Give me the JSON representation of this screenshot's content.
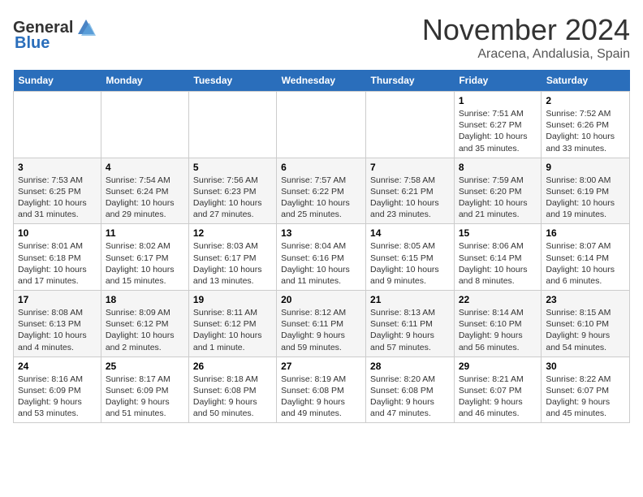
{
  "header": {
    "logo_general": "General",
    "logo_blue": "Blue",
    "month": "November 2024",
    "location": "Aracena, Andalusia, Spain"
  },
  "weekdays": [
    "Sunday",
    "Monday",
    "Tuesday",
    "Wednesday",
    "Thursday",
    "Friday",
    "Saturday"
  ],
  "weeks": [
    [
      {
        "day": "",
        "info": ""
      },
      {
        "day": "",
        "info": ""
      },
      {
        "day": "",
        "info": ""
      },
      {
        "day": "",
        "info": ""
      },
      {
        "day": "",
        "info": ""
      },
      {
        "day": "1",
        "info": "Sunrise: 7:51 AM\nSunset: 6:27 PM\nDaylight: 10 hours and 35 minutes."
      },
      {
        "day": "2",
        "info": "Sunrise: 7:52 AM\nSunset: 6:26 PM\nDaylight: 10 hours and 33 minutes."
      }
    ],
    [
      {
        "day": "3",
        "info": "Sunrise: 7:53 AM\nSunset: 6:25 PM\nDaylight: 10 hours and 31 minutes."
      },
      {
        "day": "4",
        "info": "Sunrise: 7:54 AM\nSunset: 6:24 PM\nDaylight: 10 hours and 29 minutes."
      },
      {
        "day": "5",
        "info": "Sunrise: 7:56 AM\nSunset: 6:23 PM\nDaylight: 10 hours and 27 minutes."
      },
      {
        "day": "6",
        "info": "Sunrise: 7:57 AM\nSunset: 6:22 PM\nDaylight: 10 hours and 25 minutes."
      },
      {
        "day": "7",
        "info": "Sunrise: 7:58 AM\nSunset: 6:21 PM\nDaylight: 10 hours and 23 minutes."
      },
      {
        "day": "8",
        "info": "Sunrise: 7:59 AM\nSunset: 6:20 PM\nDaylight: 10 hours and 21 minutes."
      },
      {
        "day": "9",
        "info": "Sunrise: 8:00 AM\nSunset: 6:19 PM\nDaylight: 10 hours and 19 minutes."
      }
    ],
    [
      {
        "day": "10",
        "info": "Sunrise: 8:01 AM\nSunset: 6:18 PM\nDaylight: 10 hours and 17 minutes."
      },
      {
        "day": "11",
        "info": "Sunrise: 8:02 AM\nSunset: 6:17 PM\nDaylight: 10 hours and 15 minutes."
      },
      {
        "day": "12",
        "info": "Sunrise: 8:03 AM\nSunset: 6:17 PM\nDaylight: 10 hours and 13 minutes."
      },
      {
        "day": "13",
        "info": "Sunrise: 8:04 AM\nSunset: 6:16 PM\nDaylight: 10 hours and 11 minutes."
      },
      {
        "day": "14",
        "info": "Sunrise: 8:05 AM\nSunset: 6:15 PM\nDaylight: 10 hours and 9 minutes."
      },
      {
        "day": "15",
        "info": "Sunrise: 8:06 AM\nSunset: 6:14 PM\nDaylight: 10 hours and 8 minutes."
      },
      {
        "day": "16",
        "info": "Sunrise: 8:07 AM\nSunset: 6:14 PM\nDaylight: 10 hours and 6 minutes."
      }
    ],
    [
      {
        "day": "17",
        "info": "Sunrise: 8:08 AM\nSunset: 6:13 PM\nDaylight: 10 hours and 4 minutes."
      },
      {
        "day": "18",
        "info": "Sunrise: 8:09 AM\nSunset: 6:12 PM\nDaylight: 10 hours and 2 minutes."
      },
      {
        "day": "19",
        "info": "Sunrise: 8:11 AM\nSunset: 6:12 PM\nDaylight: 10 hours and 1 minute."
      },
      {
        "day": "20",
        "info": "Sunrise: 8:12 AM\nSunset: 6:11 PM\nDaylight: 9 hours and 59 minutes."
      },
      {
        "day": "21",
        "info": "Sunrise: 8:13 AM\nSunset: 6:11 PM\nDaylight: 9 hours and 57 minutes."
      },
      {
        "day": "22",
        "info": "Sunrise: 8:14 AM\nSunset: 6:10 PM\nDaylight: 9 hours and 56 minutes."
      },
      {
        "day": "23",
        "info": "Sunrise: 8:15 AM\nSunset: 6:10 PM\nDaylight: 9 hours and 54 minutes."
      }
    ],
    [
      {
        "day": "24",
        "info": "Sunrise: 8:16 AM\nSunset: 6:09 PM\nDaylight: 9 hours and 53 minutes."
      },
      {
        "day": "25",
        "info": "Sunrise: 8:17 AM\nSunset: 6:09 PM\nDaylight: 9 hours and 51 minutes."
      },
      {
        "day": "26",
        "info": "Sunrise: 8:18 AM\nSunset: 6:08 PM\nDaylight: 9 hours and 50 minutes."
      },
      {
        "day": "27",
        "info": "Sunrise: 8:19 AM\nSunset: 6:08 PM\nDaylight: 9 hours and 49 minutes."
      },
      {
        "day": "28",
        "info": "Sunrise: 8:20 AM\nSunset: 6:08 PM\nDaylight: 9 hours and 47 minutes."
      },
      {
        "day": "29",
        "info": "Sunrise: 8:21 AM\nSunset: 6:07 PM\nDaylight: 9 hours and 46 minutes."
      },
      {
        "day": "30",
        "info": "Sunrise: 8:22 AM\nSunset: 6:07 PM\nDaylight: 9 hours and 45 minutes."
      }
    ]
  ]
}
